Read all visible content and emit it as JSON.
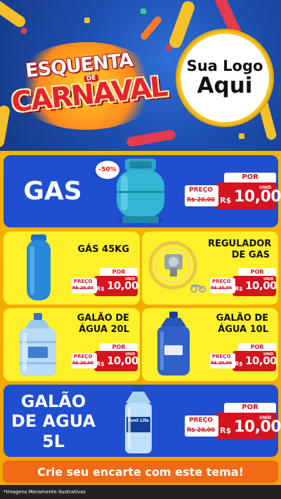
{
  "header": {
    "campaign_line_1": "ESQUENTA",
    "campaign_de": "DE",
    "campaign_line_2": "CARNAVAL",
    "logo_placeholder_line_1": "Sua Logo",
    "logo_placeholder_line_2": "Aqui"
  },
  "featured": {
    "title": "GAS",
    "discount": "-50%",
    "price": {
      "por": "POR",
      "preco": "PREÇO",
      "old": "R$ 20,00",
      "currency": "R$",
      "value": "10,00",
      "unit": "UNID"
    }
  },
  "products": [
    {
      "title": "GÁS 45KG",
      "price": {
        "por": "POR",
        "preco": "PREÇO",
        "old": "R$ 20,00",
        "currency": "R$",
        "value": "10,00",
        "unit": "UNID"
      }
    },
    {
      "title": "REGULADOR DE GAS",
      "price": {
        "por": "POR",
        "preco": "PREÇO",
        "old": "R$ 20,00",
        "currency": "R$",
        "value": "10,00",
        "unit": "UNID"
      }
    },
    {
      "title": "GALÃO DE ÁGUA 20L",
      "price": {
        "por": "POR",
        "preco": "PREÇO",
        "old": "R$ 20,00",
        "currency": "R$",
        "value": "10,00",
        "unit": "UNID"
      }
    },
    {
      "title": "GALÃO DE ÁGUA 10L",
      "price": {
        "por": "POR",
        "preco": "PREÇO",
        "old": "R$ 20,00",
        "currency": "R$",
        "value": "10,00",
        "unit": "UNID"
      }
    }
  ],
  "bottom_featured": {
    "title": "GALÃO DE AGUA 5L",
    "bottle_label": "Font Life",
    "price": {
      "por": "POR",
      "preco": "PREÇO",
      "old": "R$ 20,00",
      "currency": "R$",
      "value": "10,00",
      "unit": "UNID"
    }
  },
  "cta": "Crie seu encarte com este tema!",
  "footer_note": "*Imagens Meramente Ilustrativas",
  "colors": {
    "blue_card": "#1f4fcf",
    "yellow_card": "#fff129",
    "price_red": "#d5141f",
    "cta_orange": "#f06a17",
    "background_yellow": "#f5b400"
  }
}
